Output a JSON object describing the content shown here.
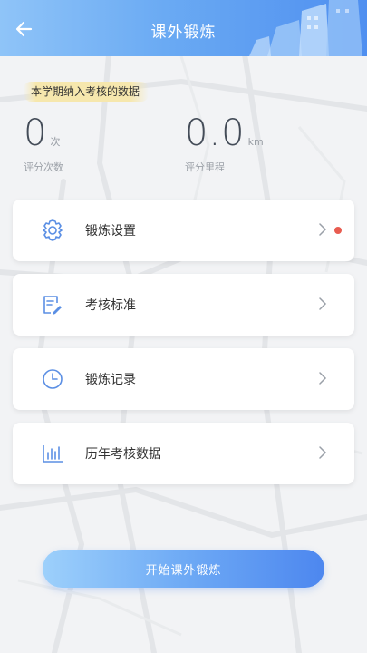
{
  "header": {
    "title": "课外锻炼",
    "back_icon": "arrow-left-icon"
  },
  "stats": {
    "tag": "本学期纳入考核的数据",
    "count": {
      "value": "0",
      "unit": "次",
      "label": "评分次数"
    },
    "distance": {
      "value": "0.0",
      "unit": "km",
      "label": "评分里程"
    }
  },
  "menu": {
    "items": [
      {
        "label": "锻炼设置",
        "icon": "gear-icon",
        "has_badge": true
      },
      {
        "label": "考核标准",
        "icon": "document-edit-icon",
        "has_badge": false
      },
      {
        "label": "锻炼记录",
        "icon": "clock-icon",
        "has_badge": false
      },
      {
        "label": "历年考核数据",
        "icon": "bar-chart-icon",
        "has_badge": false
      }
    ]
  },
  "start_button": {
    "label": "开始课外锻炼"
  },
  "colors": {
    "accent": "#4f8ff0",
    "icon_blue": "#5b8fe4",
    "badge": "#e85c50",
    "tag_bg": "#f6e7ad"
  }
}
